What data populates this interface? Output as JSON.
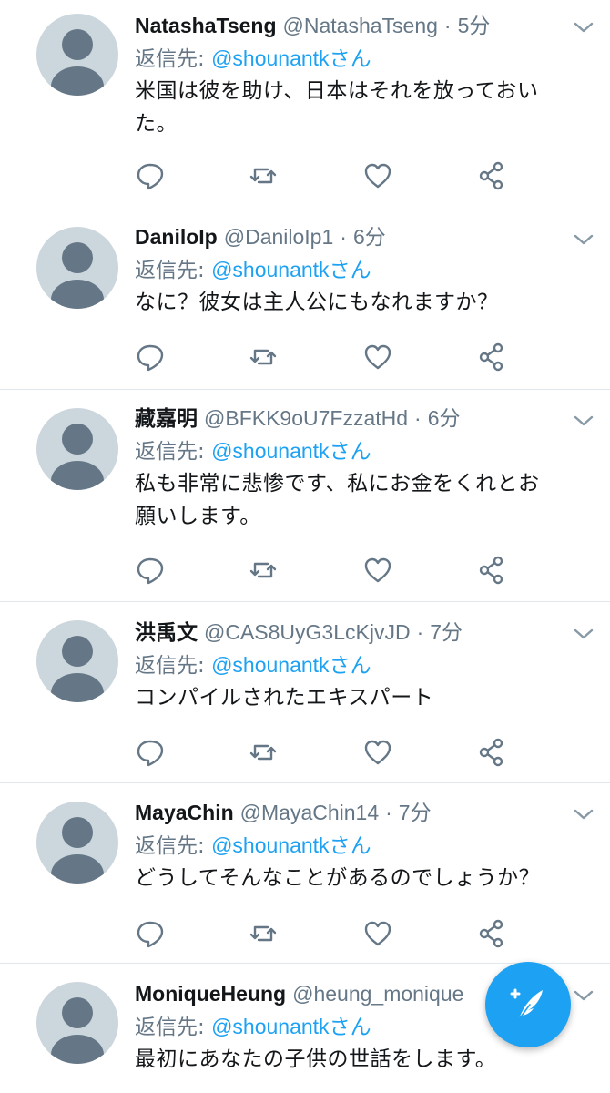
{
  "theme": {
    "accent": "#1da1f2",
    "secondary_text": "#657786",
    "primary_text": "#14171a",
    "divider": "#e1e8ed",
    "avatar_bg": "#ccd6dd"
  },
  "tweets": [
    {
      "name": "NatashaTseng",
      "handle": "@NatashaTseng",
      "separator": "·",
      "time": "5分",
      "reply_prefix": "返信先:",
      "reply_mention": "@shounantk",
      "reply_suffix": "さん",
      "text_lines": [
        "米国は彼を助け、日本はそれを放っておい",
        "た。"
      ]
    },
    {
      "name": "DaniloIp",
      "handle": "@DaniloIp1",
      "separator": "·",
      "time": "6分",
      "reply_prefix": "返信先:",
      "reply_mention": "@shounantk",
      "reply_suffix": "さん",
      "text_lines": [
        "なに？彼女は主人公にもなれますか？"
      ]
    },
    {
      "name": "藏嘉明",
      "handle": "@BFKK9oU7FzzatHd",
      "separator": "·",
      "time": "6分",
      "reply_prefix": "返信先:",
      "reply_mention": "@shounantk",
      "reply_suffix": "さん",
      "text_lines": [
        "私も非常に悲惨です、私にお金をくれとお",
        "願いします。"
      ]
    },
    {
      "name": "洪禹文",
      "handle": "@CAS8UyG3LcKjvJD",
      "separator": "·",
      "time": "7分",
      "reply_prefix": "返信先:",
      "reply_mention": "@shounantk",
      "reply_suffix": "さん",
      "text_lines": [
        "コンパイルされたエキスパート"
      ]
    },
    {
      "name": "MayaChin",
      "handle": "@MayaChin14",
      "separator": "·",
      "time": "7分",
      "reply_prefix": "返信先:",
      "reply_mention": "@shounantk",
      "reply_suffix": "さん",
      "text_lines": [
        "どうしてそんなことがあるのでしょうか？"
      ]
    },
    {
      "name": "MoniqueHeung",
      "handle": "@heung_monique",
      "separator": "·",
      "time": "",
      "reply_prefix": "返信先:",
      "reply_mention": "@shounantk",
      "reply_suffix": "さん",
      "text_lines": [
        "最初にあなたの子供の世話をします。"
      ]
    }
  ],
  "icons": {
    "caret": "chevron-down-icon",
    "reply": "reply-icon",
    "retweet": "retweet-icon",
    "like": "heart-icon",
    "share": "share-icon",
    "compose": "compose-tweet-icon"
  }
}
